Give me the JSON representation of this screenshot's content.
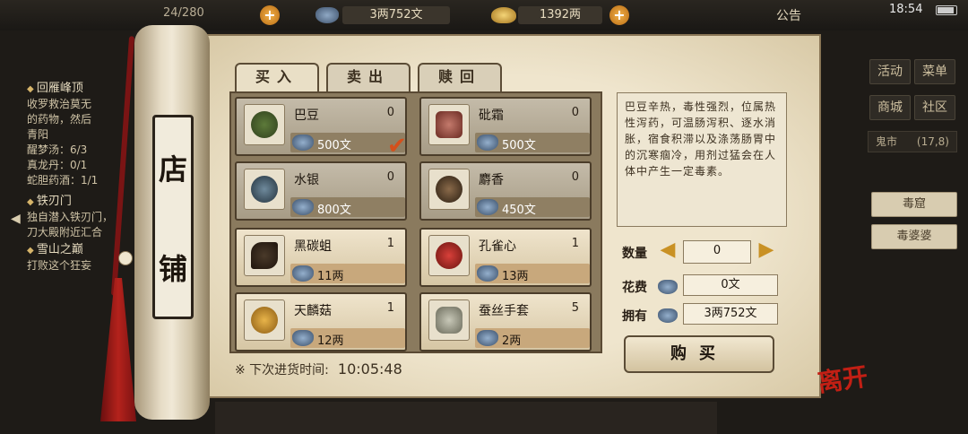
{
  "status_bar": {
    "bag_capacity": "24/280",
    "silver": "3两752文",
    "gold": "1392两",
    "notice": "公告",
    "time": "18:54"
  },
  "quests": [
    {
      "title": "回雁峰顶",
      "desc": [
        "收罗救治莫无",
        "的药物，然后",
        "青阳"
      ],
      "progress": [
        "醒梦汤：6/3",
        "真龙丹：0/1",
        "蛇胆药酒：1/1"
      ]
    },
    {
      "title": "铁刃门",
      "desc": [
        "独自潜入铁刃门，",
        "刀大殿附近汇合"
      ],
      "progress": []
    },
    {
      "title": "雪山之巅",
      "desc": [
        "打败这个狂妄"
      ],
      "progress": []
    }
  ],
  "right_menu": {
    "buttons": [
      "活动",
      "菜单",
      "商城",
      "社区"
    ],
    "location": "鬼市",
    "location_coord": "(17,8)",
    "side_items": [
      "毒窟",
      "毒婆婆"
    ]
  },
  "shop": {
    "scroll_title": [
      "店",
      "铺"
    ],
    "tabs": [
      "买入",
      "卖出",
      "赎回"
    ],
    "active_tab": 0,
    "items": [
      {
        "name": "巴豆",
        "qty": "0",
        "price": "500文",
        "selected": true
      },
      {
        "name": "砒霜",
        "qty": "0",
        "price": "500文",
        "selected": false
      },
      {
        "name": "水银",
        "qty": "0",
        "price": "800文",
        "selected": false
      },
      {
        "name": "麝香",
        "qty": "0",
        "price": "450文",
        "selected": false
      },
      {
        "name": "黑碳蛆",
        "qty": "1",
        "price": "11两",
        "selected": false
      },
      {
        "name": "孔雀心",
        "qty": "1",
        "price": "13两",
        "selected": false
      },
      {
        "name": "天麟菇",
        "qty": "1",
        "price": "12两",
        "selected": false
      },
      {
        "name": "蚕丝手套",
        "qty": "5",
        "price": "2两",
        "selected": false
      }
    ],
    "restock_label": "※ 下次进货时间:",
    "restock_time": "10:05:48",
    "description": "巴豆辛热，毒性强烈，位属热性泻药，可温肠泻积、逐水消胀，宿食积滞以及涤荡肠胃中的沉寒痼冷，用剂过猛会在人体中产生一定毒素。",
    "quantity_label": "数量",
    "quantity_value": "0",
    "cost_label": "花费",
    "cost_value": "0文",
    "owned_label": "拥有",
    "owned_value": "3两752文",
    "buy_button": "购买",
    "leave_button": "离开"
  },
  "colors": {
    "accent_red": "#c21f14",
    "check_orange": "#d4501c",
    "arrow_gold": "#c99124"
  }
}
